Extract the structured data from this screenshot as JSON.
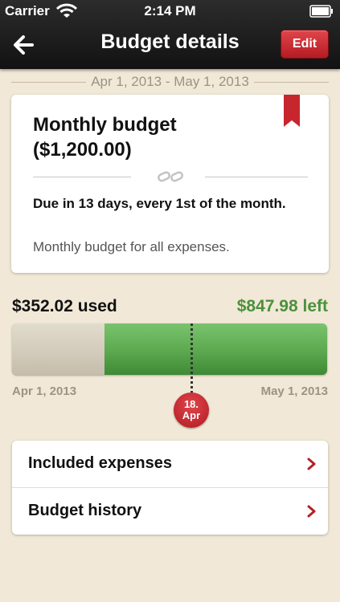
{
  "status_bar": {
    "carrier": "Carrier",
    "time": "2:14 PM"
  },
  "nav": {
    "title": "Budget details",
    "edit_label": "Edit"
  },
  "period": {
    "range": "Apr 1, 2013 - May 1, 2013"
  },
  "budget": {
    "title_line1": "Monthly budget",
    "title_line2": "($1,200.00)",
    "due": "Due in 13 days, every 1st of the month.",
    "description": "Monthly budget for all expenses."
  },
  "usage": {
    "used": "$352.02 used",
    "left": "$847.98 left",
    "used_fraction": 0.293,
    "today_fraction": 0.57,
    "start": "Apr 1, 2013",
    "end": "May 1, 2013",
    "today_day": "18.",
    "today_month": "Apr"
  },
  "menu": {
    "items": [
      {
        "label": "Included expenses"
      },
      {
        "label": "Budget history"
      }
    ]
  },
  "colors": {
    "accent_red": "#c7262d",
    "left_green": "#4b913c",
    "bar_green": "#5ba84f"
  }
}
